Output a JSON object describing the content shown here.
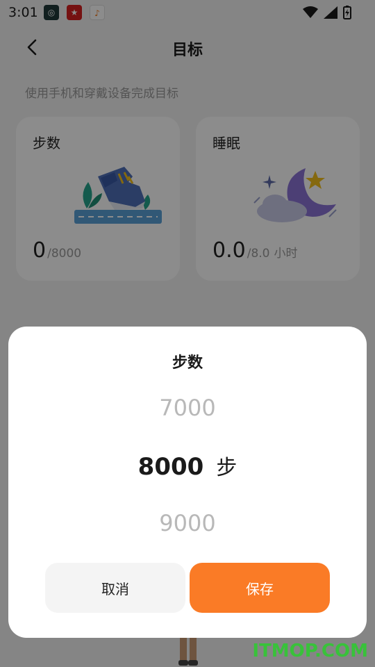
{
  "status_bar": {
    "time": "3:01"
  },
  "header": {
    "title": "目标"
  },
  "subtitle": "使用手机和穿戴设备完成目标",
  "cards": {
    "steps": {
      "title": "步数",
      "value": "0",
      "goal": "/8000",
      "unit": ""
    },
    "sleep": {
      "title": "睡眠",
      "value": "0.0",
      "goal": "/8.0",
      "unit": "小时"
    }
  },
  "dialog": {
    "title": "步数",
    "picker": {
      "prev": "7000",
      "selected": "8000",
      "unit": "步",
      "next": "9000"
    },
    "cancel_label": "取消",
    "save_label": "保存"
  },
  "watermark": "ITMOP.COM",
  "colors": {
    "accent": "#fa7b26",
    "watermark": "#38c23a",
    "overlay": "rgba(0,0,0,0.45)"
  }
}
